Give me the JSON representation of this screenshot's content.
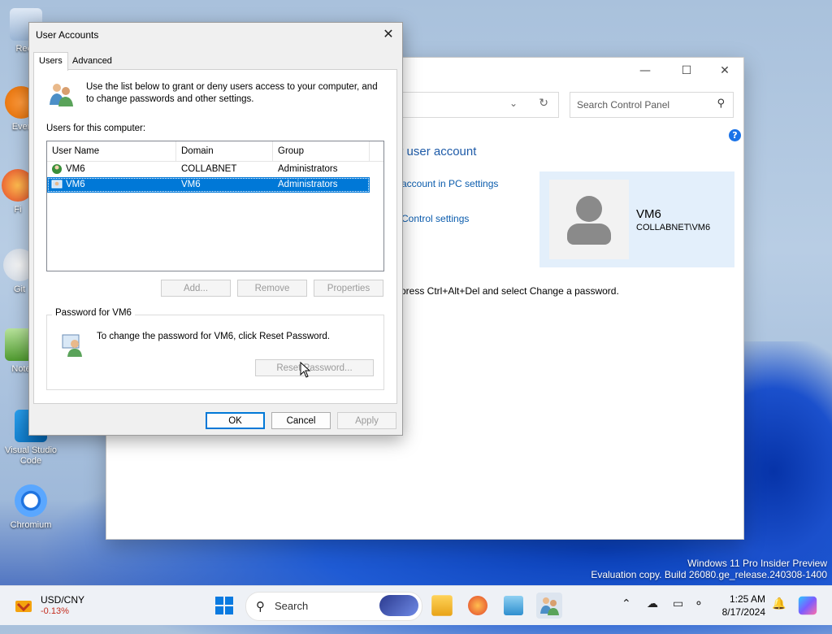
{
  "desktop": {
    "icons": [
      {
        "label": "Recy"
      },
      {
        "label": "Ever"
      },
      {
        "label": "Fi"
      },
      {
        "label": "Git"
      },
      {
        "label": "Note"
      },
      {
        "label": "Visual Studio Code"
      },
      {
        "label": "Chromium"
      }
    ],
    "watermark_line1": "Windows 11 Pro Insider Preview",
    "watermark_line2": "Evaluation copy. Build 26080.ge_release.240308-1400"
  },
  "control_panel": {
    "search_placeholder": "Search Control Panel",
    "heading": "ur user account",
    "link1": "account in PC settings",
    "link2": "Control settings",
    "colon_fragment": ":",
    "hint": "press Ctrl+Alt+Del and select Change a password.",
    "user_name": "VM6",
    "user_domain": "COLLABNET\\VM6",
    "help_glyph": "?"
  },
  "dialog": {
    "title": "User Accounts",
    "tabs": [
      {
        "label": "Users"
      },
      {
        "label": "Advanced"
      }
    ],
    "intro": "Use the list below to grant or deny users access to your computer, and to change passwords and other settings.",
    "users_label": "Users for this computer:",
    "columns": [
      "User Name",
      "Domain",
      "Group"
    ],
    "rows": [
      {
        "name": "VM6",
        "domain": "COLLABNET",
        "group": "Administrators"
      },
      {
        "name": "VM6",
        "domain": "VM6",
        "group": "Administrators"
      }
    ],
    "buttons": {
      "add": "Add...",
      "remove": "Remove",
      "properties": "Properties",
      "reset": "Reset Password...",
      "ok": "OK",
      "cancel": "Cancel",
      "apply": "Apply"
    },
    "password_group_title": "Password for VM6",
    "password_text": "To change the password for VM6, click Reset Password."
  },
  "taskbar": {
    "widget_title": "USD/CNY",
    "widget_value": "-0.13%",
    "search_label": "Search",
    "time": "1:25 AM",
    "date": "8/17/2024"
  },
  "colors": {
    "accent": "#0078d7",
    "link": "#0b5cad",
    "negative": "#c42b1c"
  }
}
